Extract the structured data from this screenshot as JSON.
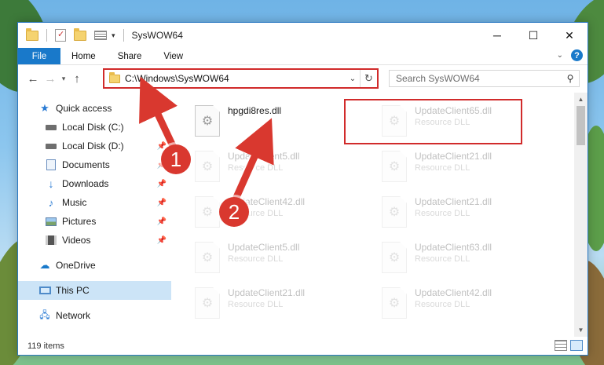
{
  "window": {
    "title": "SysWOW64",
    "controls": {
      "minimize": "─",
      "maximize": "☐",
      "close": "✕"
    }
  },
  "ribbon": {
    "file": "File",
    "tabs": [
      "Home",
      "Share",
      "View"
    ]
  },
  "nav": {
    "back": "←",
    "forward": "→",
    "up": "↑",
    "address": "C:\\Windows\\SysWOW64",
    "search_placeholder": "Search SysWOW64"
  },
  "sidebar": {
    "items": [
      {
        "label": "Quick access",
        "icon": "star-icon",
        "pinned": false
      },
      {
        "label": "Local Disk (C:)",
        "icon": "drive-icon",
        "pinned": false
      },
      {
        "label": "Local Disk (D:)",
        "icon": "drive-icon",
        "pinned": true
      },
      {
        "label": "Documents",
        "icon": "documents-icon",
        "pinned": true
      },
      {
        "label": "Downloads",
        "icon": "downloads-icon",
        "pinned": true
      },
      {
        "label": "Music",
        "icon": "music-icon",
        "pinned": true
      },
      {
        "label": "Pictures",
        "icon": "pictures-icon",
        "pinned": true
      },
      {
        "label": "Videos",
        "icon": "videos-icon",
        "pinned": true
      },
      {
        "label": "OneDrive",
        "icon": "onedrive-icon",
        "pinned": false
      },
      {
        "label": "This PC",
        "icon": "this-pc-icon",
        "pinned": false,
        "selected": true
      },
      {
        "label": "Network",
        "icon": "network-icon",
        "pinned": false
      }
    ]
  },
  "files": [
    {
      "name": "hpgdi8res.dll",
      "type": "",
      "highlighted": true
    },
    {
      "name": "UpdateClient65.dll",
      "type": "Resource DLL"
    },
    {
      "name": "UpdateClient5.dll",
      "type": "Resource DLL"
    },
    {
      "name": "UpdateClient21.dll",
      "type": "Resource DLL"
    },
    {
      "name": "UpdateClient42.dll",
      "type": "Resource DLL"
    },
    {
      "name": "UpdateClient21.dll",
      "type": "Resource DLL"
    },
    {
      "name": "UpdateClient5.dll",
      "type": "Resource DLL"
    },
    {
      "name": "UpdateClient63.dll",
      "type": "Resource DLL"
    },
    {
      "name": "UpdateClient21.dll",
      "type": "Resource DLL"
    },
    {
      "name": "UpdateClient42.dll",
      "type": "Resource DLL"
    }
  ],
  "status": {
    "items_count": "119 items"
  },
  "annotations": {
    "step1": "1",
    "step2": "2",
    "color": "#d9382f"
  }
}
